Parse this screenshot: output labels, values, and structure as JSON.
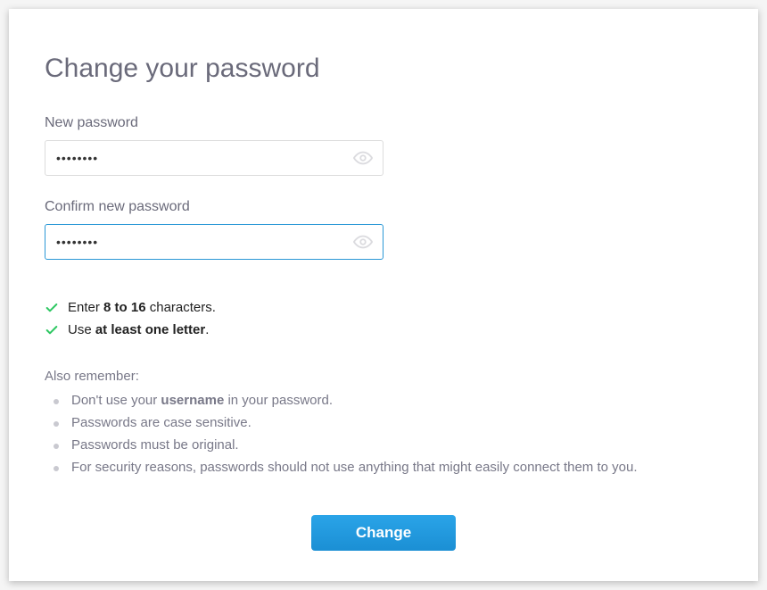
{
  "title": "Change your password",
  "fields": {
    "new_password": {
      "label": "New password",
      "value": "••••••••"
    },
    "confirm_password": {
      "label": "Confirm new password",
      "value": "••••••••"
    }
  },
  "rules": [
    {
      "pre": "Enter ",
      "bold": "8 to 16",
      "post": " characters."
    },
    {
      "pre": "Use ",
      "bold": "at least one letter",
      "post": "."
    }
  ],
  "remember_title": "Also remember:",
  "remember_items": [
    {
      "pre": "Don't use your ",
      "bold": "username",
      "post": " in your password."
    },
    {
      "pre": "Passwords are case sensitive.",
      "bold": "",
      "post": ""
    },
    {
      "pre": "Passwords must be original.",
      "bold": "",
      "post": ""
    },
    {
      "pre": "For security reasons, passwords should not use anything that might easily connect them to you.",
      "bold": "",
      "post": ""
    }
  ],
  "submit_label": "Change"
}
